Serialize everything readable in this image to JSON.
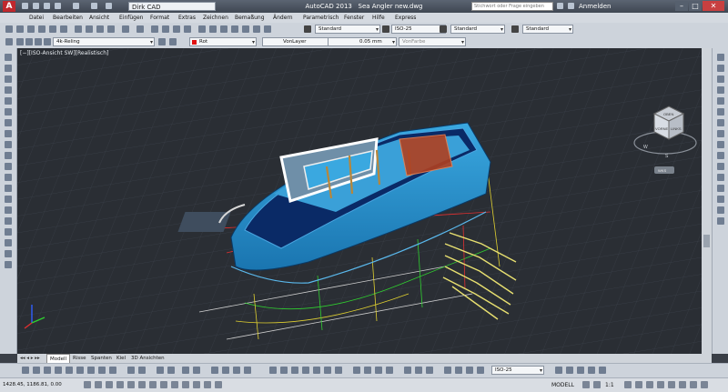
{
  "titlebar": {
    "app_logo": "A",
    "workspace": "Dirk CAD",
    "app_name": "AutoCAD 2013",
    "file_name": "Sea Angler new.dwg",
    "search_placeholder": "Stichwort oder Frage eingeben",
    "signin": "Anmelden"
  },
  "menu": {
    "items": [
      "Datei",
      "Bearbeiten",
      "Ansicht",
      "Einfügen",
      "Format",
      "Extras",
      "Zeichnen",
      "Bemaßung",
      "Ändern",
      "Parametrisch",
      "Fenster",
      "Hilfe",
      "Express"
    ]
  },
  "toolbar1": {
    "text_style": "Standard",
    "dim_style": "ISO-25",
    "table_style": "Standard",
    "multileader_style": "Standard"
  },
  "toolbar2": {
    "layer": "4k-Reling",
    "color": "Rot",
    "linetype": "VonLayer",
    "lineweight": "0.05 mm",
    "plotstyle": "VonFarbe"
  },
  "viewport": {
    "view_label": "[−][ISO-Ansicht SW][Realistisch]",
    "viewcube": {
      "front": "VORNE",
      "side": "LINKS",
      "top": "OBEN",
      "compass_s": "S",
      "compass_w": "W",
      "wcs": "WKS"
    }
  },
  "tabs": [
    "Modell",
    "Risse",
    "Spanten",
    "Kiel",
    "3D Ansichten"
  ],
  "toolbar3": {
    "dim_style": "ISO-25"
  },
  "status": {
    "coords": "1428.45, 1186.81, 0.00",
    "model": "MODELL",
    "scale": "1:1"
  },
  "colors": {
    "hull": "#1f8fcc",
    "deck": "#0a2a66",
    "viewport_bg": "#2a2e34",
    "accent_red": "#e01010"
  }
}
